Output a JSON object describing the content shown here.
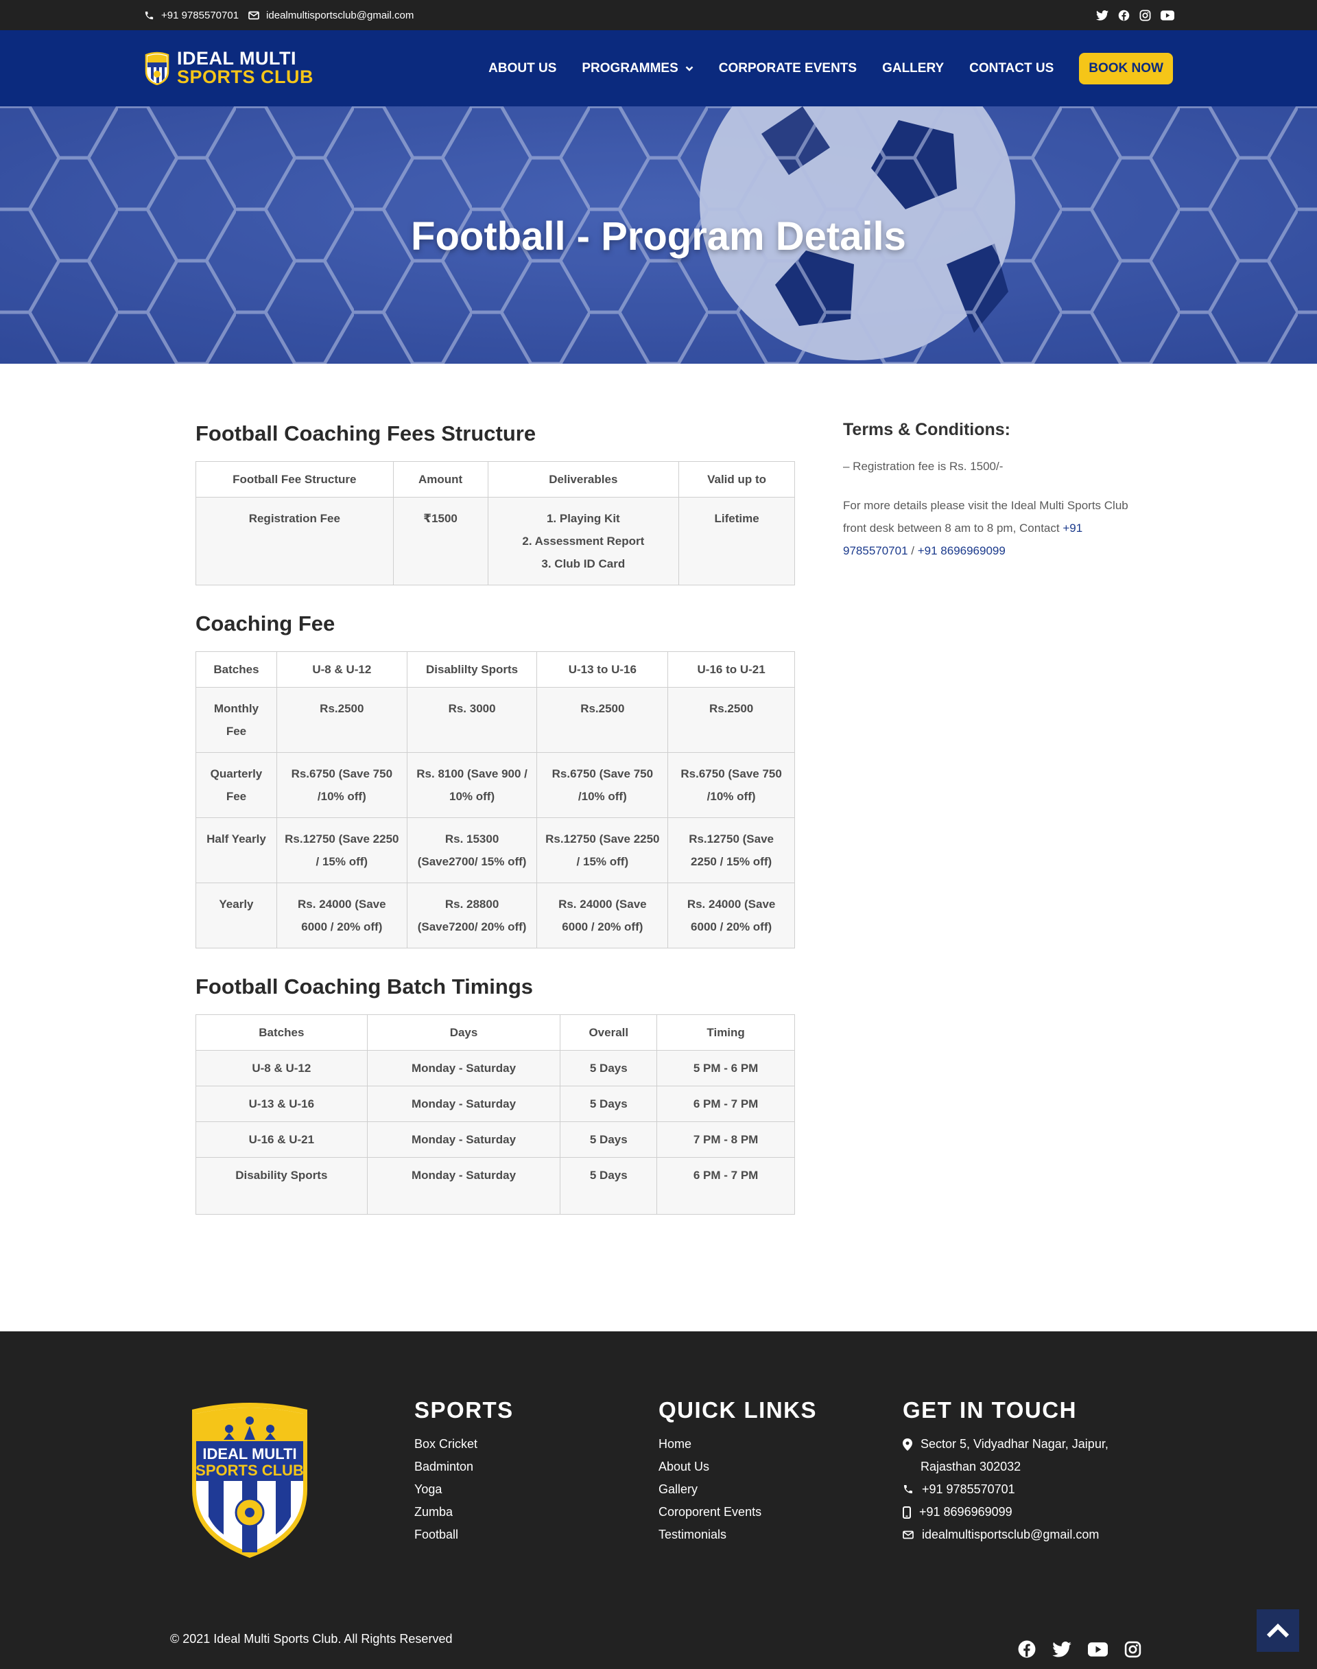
{
  "topbar": {
    "phone": "+91 9785570701",
    "email": "idealmultisportsclub@gmail.com",
    "social_icons": [
      "twitter-icon",
      "facebook-icon",
      "instagram-icon",
      "youtube-icon"
    ]
  },
  "nav": {
    "logo_line1": "IDEAL MULTI",
    "logo_line2": "SPORTS CLUB",
    "items": [
      {
        "label": "ABOUT US"
      },
      {
        "label": "PROGRAMMES"
      },
      {
        "label": "CORPORATE EVENTS"
      },
      {
        "label": "GALLERY"
      },
      {
        "label": "CONTACT US"
      }
    ],
    "cta": "BOOK NOW"
  },
  "hero": {
    "title": "Football - Program Details"
  },
  "fees": {
    "title": "Football Coaching Fees Structure",
    "headers": [
      "Football Fee Structure",
      "Amount",
      "Deliverables",
      "Valid up to"
    ],
    "row": {
      "name": "Registration Fee",
      "amount": "₹1500",
      "deliverables": [
        "1. Playing Kit",
        "2. Assessment Report",
        "3. Club ID Card"
      ],
      "valid": "Lifetime"
    }
  },
  "coaching": {
    "title": "Coaching Fee",
    "headers": [
      "Batches",
      "U-8 & U-12",
      "Disablilty Sports",
      "U-13 to U-16",
      "U-16 to U-21"
    ],
    "rows": [
      [
        "Monthly Fee",
        "Rs.2500",
        "Rs. 3000",
        "Rs.2500",
        "Rs.2500"
      ],
      [
        "Quarterly Fee",
        "Rs.6750 (Save 750 /10% off)",
        "Rs. 8100 (Save 900 / 10% off)",
        "Rs.6750 (Save 750 /10% off)",
        "Rs.6750 (Save 750 /10% off)"
      ],
      [
        "Half Yearly",
        "Rs.12750 (Save 2250 / 15% off)",
        "Rs. 15300 (Save2700/ 15% off)",
        "Rs.12750 (Save 2250 / 15% off)",
        "Rs.12750 (Save 2250 / 15% off)"
      ],
      [
        "Yearly",
        "Rs. 24000 (Save 6000 / 20% off)",
        "Rs. 28800 (Save7200/ 20% off)",
        "Rs. 24000 (Save 6000 / 20% off)",
        "Rs. 24000 (Save 6000 / 20% off)"
      ]
    ]
  },
  "timings": {
    "title": "Football Coaching Batch Timings",
    "headers": [
      "Batches",
      "Days",
      "Overall",
      "Timing"
    ],
    "rows": [
      [
        "U-8 & U-12",
        "Monday - Saturday",
        "5 Days",
        "5 PM - 6 PM"
      ],
      [
        "U-13 & U-16",
        "Monday - Saturday",
        "5 Days",
        "6 PM - 7 PM"
      ],
      [
        "U-16 & U-21",
        "Monday - Saturday",
        "5 Days",
        "7 PM - 8 PM"
      ],
      [
        "Disability Sports",
        "Monday - Saturday",
        "5 Days",
        "6 PM - 7 PM"
      ]
    ]
  },
  "terms": {
    "title": "Terms & Conditions:",
    "line1": "– Registration fee is Rs. 1500/-",
    "line2": "For more details please visit the Ideal Multi Sports Club front desk between 8 am to 8 pm, Contact",
    "phone1": "+91 9785570701",
    "separator": " / ",
    "phone2": "+91 8696969099"
  },
  "footer": {
    "logo_line1": "IDEAL MULTI",
    "logo_line2": "SPORTS CLUB",
    "sports_title": "SPORTS",
    "sports": [
      "Box Cricket",
      "Badminton",
      "Yoga",
      "Zumba",
      "Football"
    ],
    "links_title": "QUICK LINKS",
    "links": [
      "Home",
      "About Us",
      "Gallery",
      "Coroporent Events",
      "Testimonials"
    ],
    "touch_title": "GET IN TOUCH",
    "address_line1": "Sector 5, Vidyadhar Nagar, Jaipur,",
    "address_line2": "Rajasthan 302032",
    "phone": "+91 9785570701",
    "mobile": "+91 8696969099",
    "email": "idealmultisportsclub@gmail.com",
    "copyright": "© 2021 Ideal Multi Sports Club. All Rights Reserved",
    "social_icons": [
      "facebook-icon",
      "twitter-icon",
      "youtube-icon",
      "instagram-icon"
    ]
  },
  "colors": {
    "brand_blue": "#0b2a7e",
    "accent_yellow": "#f5c518",
    "dark": "#222222"
  }
}
